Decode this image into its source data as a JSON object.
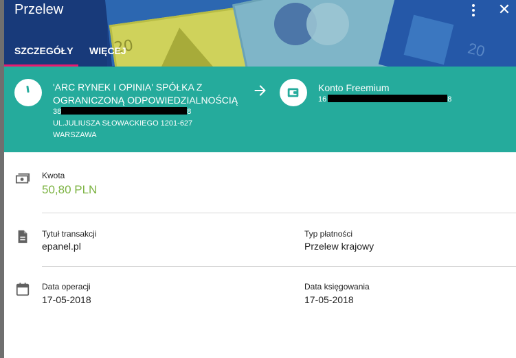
{
  "dialog": {
    "title": "Przelew",
    "tabs": [
      {
        "label": "SZCZEGÓŁY",
        "active": true
      },
      {
        "label": "WIĘCEJ",
        "active": false
      }
    ],
    "close_label": "✕"
  },
  "sender": {
    "name": "'ARC RYNEK I OPINIA' SPÓŁKA Z OGRANICZONĄ ODPOWIEDZIALNOŚCIĄ",
    "account_prefix": "38",
    "account_suffix": "8",
    "address_line1": "UL.JULIUSZA SŁOWACKIEGO 1201-627",
    "address_line2": "WARSZAWA"
  },
  "recipient": {
    "name": "Konto Freemium",
    "account_prefix": "16",
    "account_suffix": "8"
  },
  "details": {
    "amount_label": "Kwota",
    "amount_value": "50,80 PLN",
    "title_label": "Tytuł transakcji",
    "title_value": "epanel.pl",
    "payment_type_label": "Typ płatności",
    "payment_type_value": "Przelew krajowy",
    "operation_date_label": "Data operacji",
    "operation_date_value": "17-05-2018",
    "booking_date_label": "Data księgowania",
    "booking_date_value": "17-05-2018"
  },
  "icons": {
    "amount": "money-icon",
    "title": "document-icon",
    "date": "calendar-icon",
    "arrow": "arrow-right-icon",
    "wallet": "wallet-icon",
    "menu": "more-vert-icon",
    "close": "close-icon"
  },
  "colors": {
    "header_bg": "#1a3e82",
    "teal": "#25ab9c",
    "tab_indicator": "#e8196f",
    "amount": "#7cb342"
  }
}
